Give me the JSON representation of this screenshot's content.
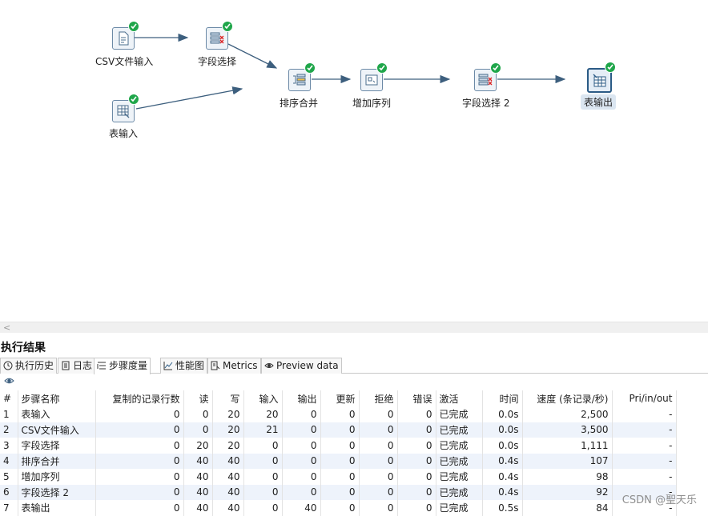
{
  "canvas": {
    "nodes": [
      {
        "id": "csv-input",
        "label": "CSV文件输入",
        "icon": "csv-file-icon"
      },
      {
        "id": "select-values-1",
        "label": "字段选择",
        "icon": "select-values-icon"
      },
      {
        "id": "table-input",
        "label": "表输入",
        "icon": "table-input-icon"
      },
      {
        "id": "sorted-merge",
        "label": "排序合并",
        "icon": "sorted-merge-icon"
      },
      {
        "id": "add-sequence",
        "label": "增加序列",
        "icon": "add-sequence-icon"
      },
      {
        "id": "select-values-2",
        "label": "字段选择 2",
        "icon": "select-values-icon"
      },
      {
        "id": "table-output",
        "label": "表输出",
        "icon": "table-output-icon"
      }
    ],
    "status_icon": "success-check-icon",
    "hop_color": "#3d5f7e"
  },
  "results": {
    "title": "执行结果",
    "tabs": [
      {
        "label": "执行历史",
        "icon": "history-icon"
      },
      {
        "label": "日志",
        "icon": "log-icon"
      },
      {
        "label": "步骤度量",
        "icon": "step-metrics-icon"
      },
      {
        "label": "性能图",
        "icon": "performance-chart-icon"
      },
      {
        "label": "Metrics",
        "icon": "metrics-icon"
      },
      {
        "label": "Preview data",
        "icon": "preview-eye-icon"
      }
    ],
    "active_tab": "步骤度量",
    "columns": [
      "#",
      "步骤名称",
      "复制的记录行数",
      "读",
      "写",
      "输入",
      "输出",
      "更新",
      "拒绝",
      "错误",
      "激活",
      "时间",
      "速度 (条记录/秒)",
      "Pri/in/out"
    ],
    "rows": [
      [
        "1",
        "表输入",
        "0",
        "0",
        "20",
        "20",
        "0",
        "0",
        "0",
        "0",
        "已完成",
        "0.0s",
        "2,500",
        "-"
      ],
      [
        "2",
        "CSV文件输入",
        "0",
        "0",
        "20",
        "21",
        "0",
        "0",
        "0",
        "0",
        "已完成",
        "0.0s",
        "3,500",
        "-"
      ],
      [
        "3",
        "字段选择",
        "0",
        "20",
        "20",
        "0",
        "0",
        "0",
        "0",
        "0",
        "已完成",
        "0.0s",
        "1,111",
        "-"
      ],
      [
        "4",
        "排序合并",
        "0",
        "40",
        "40",
        "0",
        "0",
        "0",
        "0",
        "0",
        "已完成",
        "0.4s",
        "107",
        "-"
      ],
      [
        "5",
        "增加序列",
        "0",
        "40",
        "40",
        "0",
        "0",
        "0",
        "0",
        "0",
        "已完成",
        "0.4s",
        "98",
        "-"
      ],
      [
        "6",
        "字段选择 2",
        "0",
        "40",
        "40",
        "0",
        "0",
        "0",
        "0",
        "0",
        "已完成",
        "0.4s",
        "92",
        "-"
      ],
      [
        "7",
        "表输出",
        "0",
        "40",
        "40",
        "0",
        "40",
        "0",
        "0",
        "0",
        "已完成",
        "0.5s",
        "84",
        "-"
      ]
    ]
  },
  "watermark": "CSDN @聖天乐"
}
